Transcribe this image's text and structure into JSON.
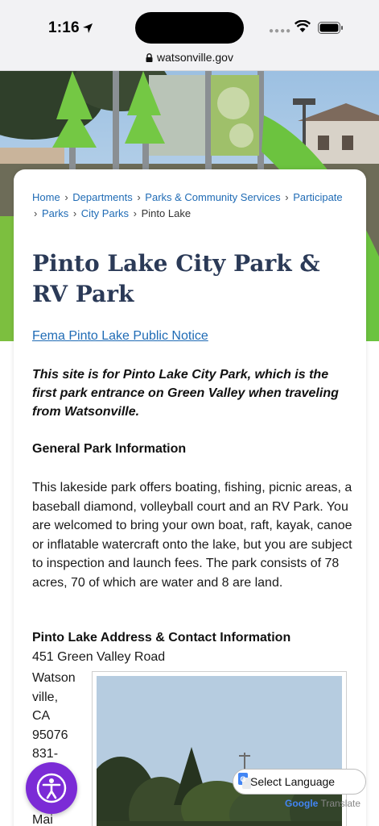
{
  "status": {
    "time": "1:16"
  },
  "browser": {
    "url": "watsonville.gov"
  },
  "breadcrumb": {
    "items": [
      "Home",
      "Departments",
      "Parks & Community Services",
      "Participate",
      "Parks",
      "City Parks"
    ],
    "current": "Pinto Lake",
    "separator": "›"
  },
  "page": {
    "title": "Pinto Lake City Park & RV Park",
    "notice_link": "Fema Pinto Lake Public Notice",
    "intro": "This site is for Pinto Lake City Park, which is the first park entrance on Green Valley when traveling from Watsonville.",
    "general_heading": "General Park Information",
    "general_body": "This lakeside park offers boating, fishing, picnic areas, a baseball diamond, volleyball court and an RV Park. You are welcomed to bring your own boat, raft, kayak, canoe or inflatable watercraft onto the lake, but you are subject to inspection and launch fees. The park consists of 78 acres, 70 of which are water and 8 are land.",
    "address_heading": "Pinto Lake Address & Contact Information",
    "address_line": "451 Green Valley Road",
    "city": "Watsonville,",
    "state": "CA",
    "zip": "95076",
    "phone_partial": "831-",
    "next_partial": "Mai"
  },
  "translate": {
    "select_label": "Select Language",
    "powered_prefix": "Google",
    "powered_suffix": "Translate"
  },
  "colors": {
    "link": "#1f6bb5",
    "title": "#2b3a57",
    "accessibility_button": "#7b2bd6"
  },
  "icons": [
    "location-arrow-icon",
    "wifi-icon",
    "battery-icon",
    "lock-icon",
    "accessibility-icon",
    "google-translate-icon"
  ]
}
